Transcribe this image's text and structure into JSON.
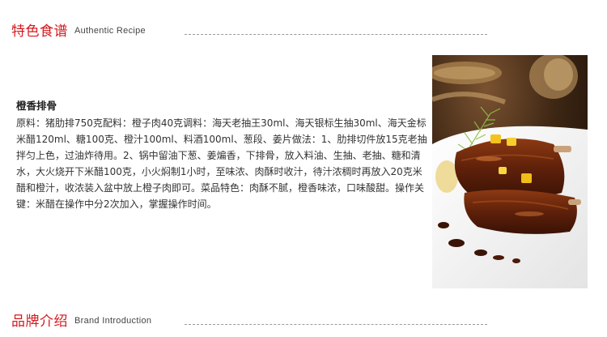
{
  "section_recipe": {
    "title_zh": "特色食谱",
    "title_en": "Authentic Recipe"
  },
  "recipe": {
    "name": "橙香排骨",
    "body": "原料：猪肋排750克配料：橙子肉40克调料：海天老抽王30ml、海天银标生抽30ml、海天金标米醋120ml、糖100克、橙汁100ml、料酒100ml、葱段、姜片做法：1、肋排切件放15克老抽拌匀上色，过油炸待用。2、锅中留油下葱、姜煸香，下排骨，放入料油、生抽、老抽、糖和清水，大火烧开下米醋100克，小火焖制1小时，至味浓、肉酥时收汁，待汁浓稠时再放入20克米醋和橙汁，收浓装入盆中放上橙子肉即可。菜品特色：肉酥不腻，橙香味浓，口味酸甜。操作关键：米醋在操作中分2次加入，掌握操作时间。"
  },
  "section_brand": {
    "title_zh": "品牌介绍",
    "title_en": "Brand Introduction"
  },
  "colors": {
    "accent": "#d4191f",
    "text": "#333333",
    "divider": "#9a9a9a"
  },
  "photo": {
    "subject": "orange-glazed braised pork ribs on white plate with dill garnish"
  }
}
